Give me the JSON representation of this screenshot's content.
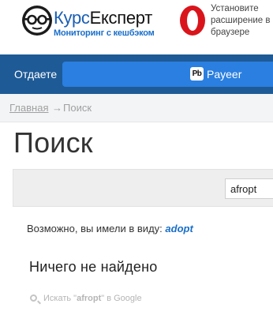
{
  "header": {
    "brand_part1": "Курс",
    "brand_part2": "Експерт",
    "tagline": "Мониторинг с кешбэком",
    "extension_promo": "Установите расширение в браузере"
  },
  "navbar": {
    "give_label": "Отдаете",
    "selected_currency": "Payeer",
    "currency_icon_text": "Pb"
  },
  "breadcrumb": {
    "home": "Главная",
    "separator": "→",
    "current": "Поиск"
  },
  "page": {
    "title": "Поиск"
  },
  "search": {
    "value": "afropt"
  },
  "suggestion": {
    "prefix": "Возможно, вы имели в виду:",
    "term": "adopt"
  },
  "results": {
    "empty_message": "Ничего не найдено"
  },
  "google_search": {
    "before": "Искать \"",
    "query": "afropt",
    "after": "\" в Google"
  },
  "colors": {
    "navbar_bg": "#1e5a96",
    "select_bg": "#2a7fe0",
    "link": "#1a6fc9",
    "opera_red": "#d9151b"
  },
  "icons": {
    "logo": "glasses-face-icon",
    "browser": "opera-icon",
    "currency": "payeer-icon",
    "search": "search-icon"
  }
}
